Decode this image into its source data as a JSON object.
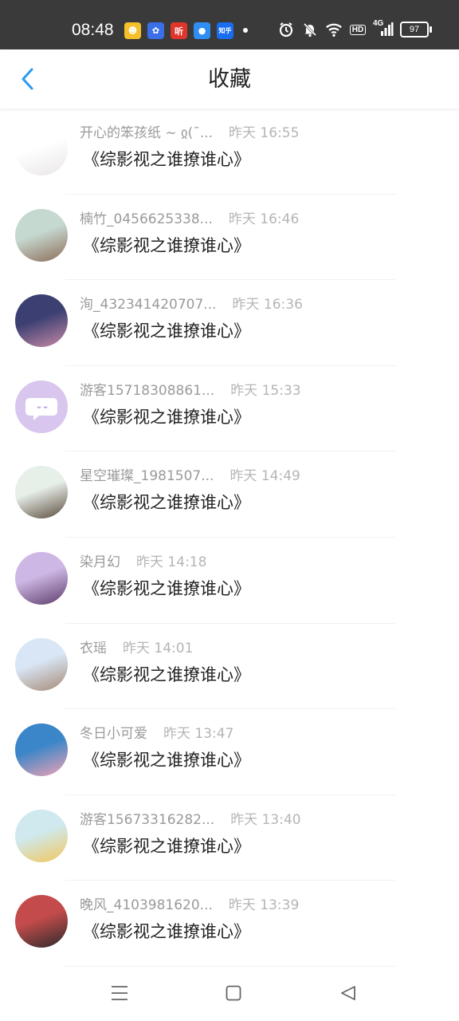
{
  "status_bar": {
    "time": "08:48",
    "apps": [
      {
        "icon": "emoji-app-icon",
        "color": "#f4c12b",
        "glyph": "☻"
      },
      {
        "icon": "paw-app-icon",
        "color": "#3a6fe8",
        "glyph": "✿"
      },
      {
        "icon": "listen-app-icon",
        "color": "#e0352b",
        "glyph": "听"
      },
      {
        "icon": "circle-app-icon",
        "color": "#2f8ef5",
        "glyph": "●"
      },
      {
        "icon": "zhihu-app-icon",
        "color": "#1a6df0",
        "glyph": "知乎"
      }
    ],
    "hd": "HD",
    "network": "4G",
    "battery": "97"
  },
  "header": {
    "title": "收藏"
  },
  "items": [
    {
      "name": "开心的笨孩纸 ~ ჲ(¯...",
      "time": "昨天 16:55",
      "book": "《综影视之谁撩谁心》",
      "avatar": [
        "#ffffff",
        "#e9e6e6"
      ]
    },
    {
      "name": "楠竹_0456625338...",
      "time": "昨天 16:46",
      "book": "《综影视之谁撩谁心》",
      "avatar": [
        "#c6d9d1",
        "#8d6c58"
      ]
    },
    {
      "name": "洵_432341420707...",
      "time": "昨天 16:36",
      "book": "《综影视之谁撩谁心》",
      "avatar": [
        "#3b3f72",
        "#c88aa6"
      ]
    },
    {
      "name": "游客15718308861...",
      "time": "昨天 15:33",
      "book": "《综影视之谁撩谁心》",
      "avatar": [
        "#d9c6ee",
        "#d9c6ee"
      ]
    },
    {
      "name": "星空璀璨_1981507...",
      "time": "昨天 14:49",
      "book": "《综影视之谁撩谁心》",
      "avatar": [
        "#e7efe9",
        "#5a4a3c"
      ]
    },
    {
      "name": "染月幻",
      "time": "昨天 14:18",
      "book": "《综影视之谁撩谁心》",
      "avatar": [
        "#cdb7e4",
        "#5d3b69"
      ]
    },
    {
      "name": "衣瑶",
      "time": "昨天 14:01",
      "book": "《综影视之谁撩谁心》",
      "avatar": [
        "#d9e6f6",
        "#a58a75"
      ]
    },
    {
      "name": "冬日小可爱",
      "time": "昨天 13:47",
      "book": "《综影视之谁撩谁心》",
      "avatar": [
        "#3a86c8",
        "#f0a2b5"
      ]
    },
    {
      "name": "游客15673316282...",
      "time": "昨天 13:40",
      "book": "《综影视之谁撩谁心》",
      "avatar": [
        "#cfe9ee",
        "#f2c75b"
      ]
    },
    {
      "name": "晚风_4103981620...",
      "time": "昨天 13:39",
      "book": "《综影视之谁撩谁心》",
      "avatar": [
        "#c44b4b",
        "#2b2b2b"
      ]
    }
  ]
}
